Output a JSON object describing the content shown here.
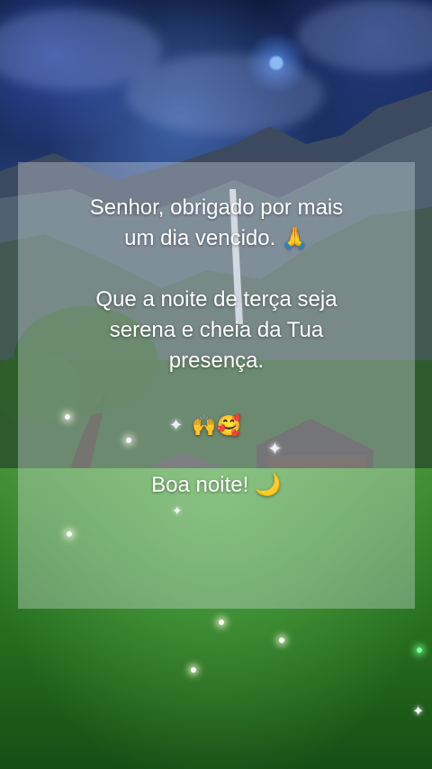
{
  "message": {
    "line1": "Senhor, obrigado por mais",
    "line2": "um dia vencido. 🙏",
    "line3": "Que a noite de terça seja",
    "line4": "serena e cheia da Tua",
    "line5": "presença.",
    "emojis": "🙌🥰",
    "closing": "Boa noite! 🌙"
  },
  "colors": {
    "sky": "#1c2f63",
    "grass": "#2f7d27",
    "card": "#e1e8ec",
    "text": "#ffffff"
  }
}
